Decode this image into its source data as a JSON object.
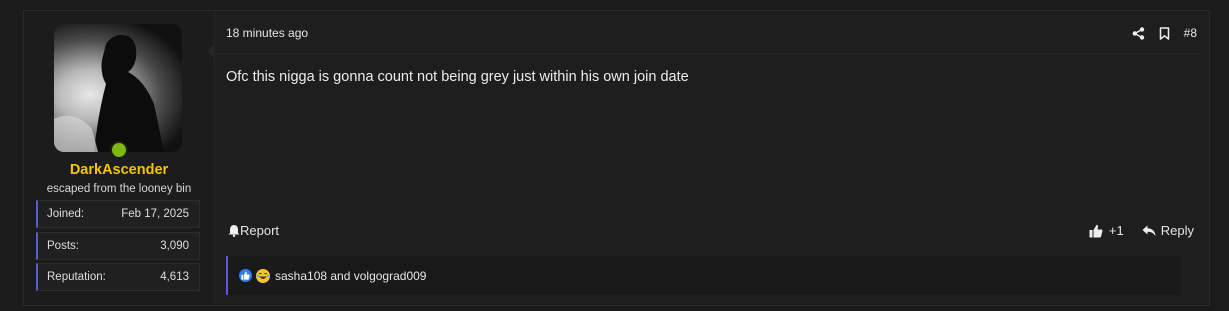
{
  "user": {
    "username": "DarkAscender",
    "title": "escaped from the looney bin",
    "stats": [
      {
        "label": "Joined:",
        "value": "Feb 17, 2025"
      },
      {
        "label": "Posts:",
        "value": "3,090"
      },
      {
        "label": "Reputation:",
        "value": "4,613"
      }
    ],
    "online_color": "#7fb80e",
    "username_color": "#f5c400"
  },
  "post": {
    "timestamp": "18 minutes ago",
    "number": "#8",
    "content": "Ofc this nigga is gonna count not being grey just within his own join date",
    "report_label": "Report",
    "like_count": "+1",
    "reply_label": "Reply",
    "reactions_text": "sasha108 and volgograd009"
  },
  "icons": [
    "share-icon",
    "bookmark-icon",
    "bell-icon",
    "thumbs-up-icon",
    "reply-icon",
    "like-reaction-icon",
    "laugh-reaction-icon"
  ],
  "colors": {
    "accent": "#5b5bd6",
    "background": "#1b1b1b"
  }
}
